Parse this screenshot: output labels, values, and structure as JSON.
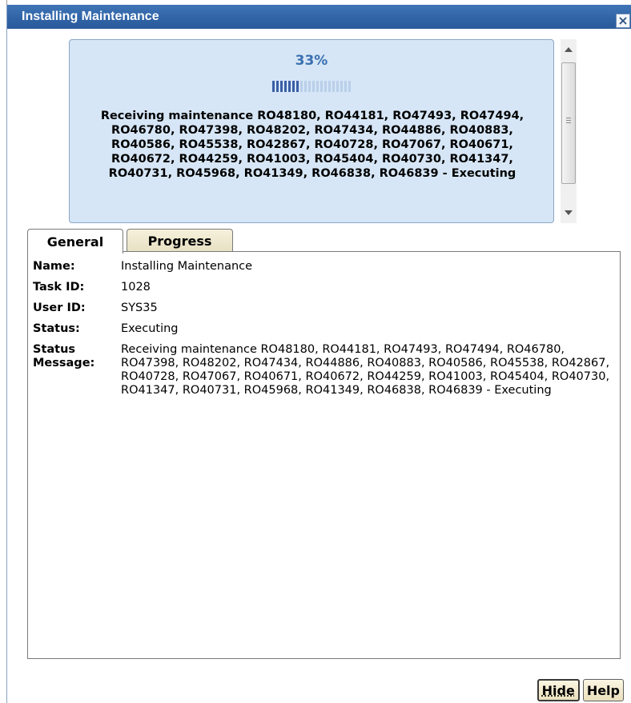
{
  "window": {
    "title": "Installing Maintenance"
  },
  "progress": {
    "percent_label": "33%",
    "percent_value": 0.33,
    "message": "Receiving maintenance RO48180, RO44181, RO47493, RO47494, RO46780, RO47398, RO48202, RO47434, RO44886, RO40883, RO40586, RO45538, RO42867, RO40728, RO47067, RO40671, RO40672, RO44259, RO41003, RO45404, RO40730, RO41347, RO40731, RO45968, RO41349, RO46838, RO46839 - Executing"
  },
  "tabs": [
    {
      "label": "General",
      "active": true
    },
    {
      "label": "Progress",
      "active": false
    }
  ],
  "general": {
    "name_label": "Name:",
    "name_value": "Installing Maintenance",
    "task_id_label": "Task ID:",
    "task_id_value": "1028",
    "user_id_label": "User ID:",
    "user_id_value": "SYS35",
    "status_label": "Status:",
    "status_value": "Executing",
    "status_message_label": "Status Message:",
    "status_message_value": "Receiving maintenance RO48180, RO44181, RO47493, RO47494, RO46780, RO47398, RO48202, RO47434, RO44886, RO40883, RO40586, RO45538, RO42867, RO40728, RO47067, RO40671, RO40672, RO44259, RO41003, RO45404, RO40730, RO41347, RO40731, RO45968, RO41349, RO46838, RO46839 - Executing"
  },
  "buttons": {
    "hide": "Hide",
    "help": "Help"
  },
  "colors": {
    "titlebar": "#2f63a6",
    "progress_panel_bg": "#d6e6f6",
    "percent_text": "#3a6fb0",
    "progress_fill": "#3a5fa6",
    "button_bg": "#f3ecd0"
  },
  "icons": {
    "close": "close-icon",
    "scroll_up": "chevron-up-icon",
    "scroll_down": "chevron-down-icon"
  }
}
